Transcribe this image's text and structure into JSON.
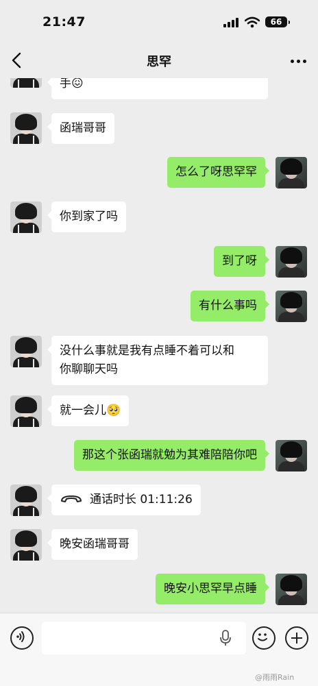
{
  "status_bar": {
    "time": "21:47",
    "battery": "66"
  },
  "header": {
    "title": "思罕"
  },
  "messages": [
    {
      "side": "in",
      "text": "手😖"
    },
    {
      "side": "in",
      "text": "函瑞哥哥"
    },
    {
      "side": "out",
      "text": "怎么了呀思罕罕"
    },
    {
      "side": "in",
      "text": "你到家了吗"
    },
    {
      "side": "out",
      "text": "到了呀"
    },
    {
      "side": "out",
      "text": "有什么事吗"
    },
    {
      "side": "in",
      "line1": "没什么事就是我有点睡不着可以和",
      "line2": "你聊聊天吗"
    },
    {
      "side": "in",
      "text": "就一会儿🥺"
    },
    {
      "side": "out",
      "text": "那这个张函瑞就勉为其难陪陪你吧"
    },
    {
      "side": "in",
      "call_label": "通话时长 01:11:26"
    },
    {
      "side": "in",
      "text": "晚安函瑞哥哥"
    },
    {
      "side": "out",
      "text": "晚安小思罕早点睡"
    }
  ],
  "input_bar": {
    "placeholder": ""
  },
  "watermark": "@雨雨Rain",
  "colors": {
    "outgoing_bubble": "#95ec69",
    "incoming_bubble": "#ffffff",
    "background": "#ededed"
  }
}
